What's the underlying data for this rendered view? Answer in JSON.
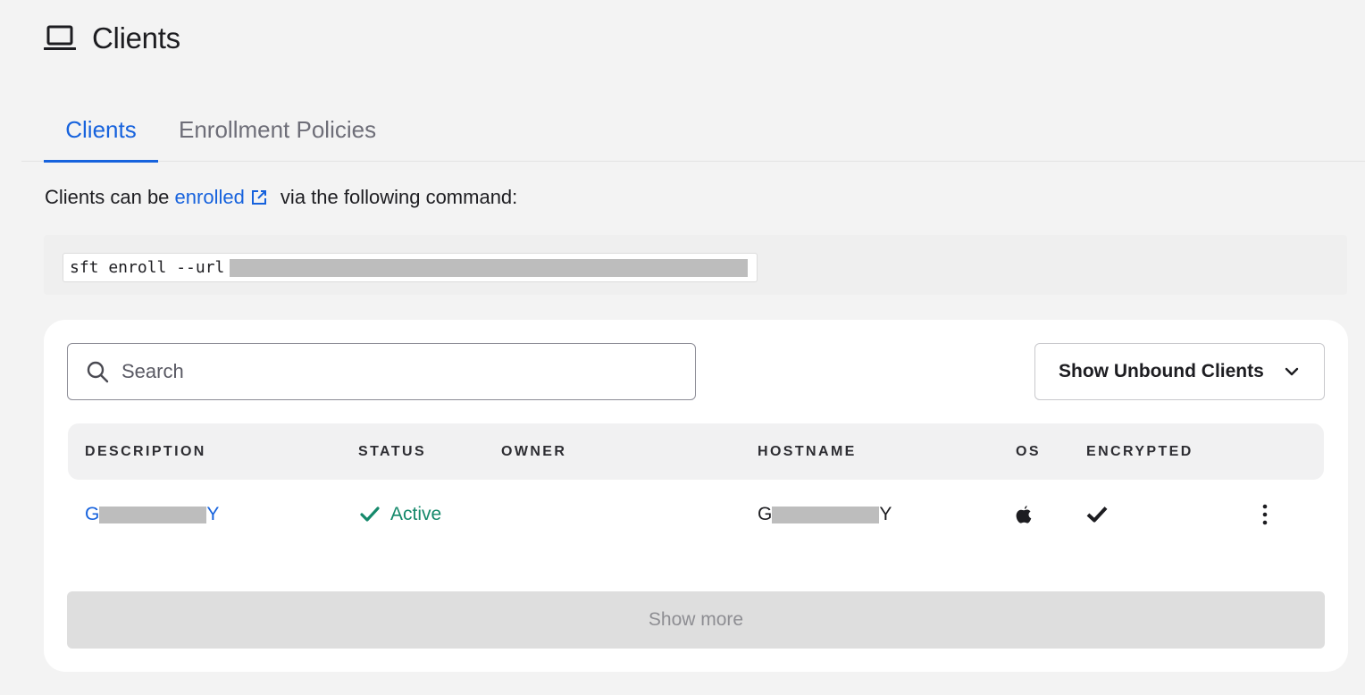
{
  "header": {
    "title": "Clients",
    "icon": "laptop-icon"
  },
  "tabs": [
    {
      "label": "Clients",
      "active": true
    },
    {
      "label": "Enrollment Policies",
      "active": false
    }
  ],
  "enroll": {
    "prefix": "Clients can be ",
    "link_text": "enrolled",
    "suffix": " via the following command:",
    "command": "sft enroll --url"
  },
  "toolbar": {
    "search_placeholder": "Search",
    "filter_label": "Show Unbound Clients"
  },
  "table": {
    "columns": [
      "DESCRIPTION",
      "STATUS",
      "OWNER",
      "HOSTNAME",
      "OS",
      "ENCRYPTED"
    ],
    "rows": [
      {
        "description_start": "G",
        "description_end": "Y",
        "status": "Active",
        "owner": "",
        "hostname_start": "G",
        "hostname_end": "Y",
        "os_icon": "apple-icon",
        "encrypted": true
      }
    ]
  },
  "show_more_label": "Show more",
  "colors": {
    "accent": "#1662dd",
    "status_active": "#15896b",
    "background": "#f3f3f3"
  }
}
